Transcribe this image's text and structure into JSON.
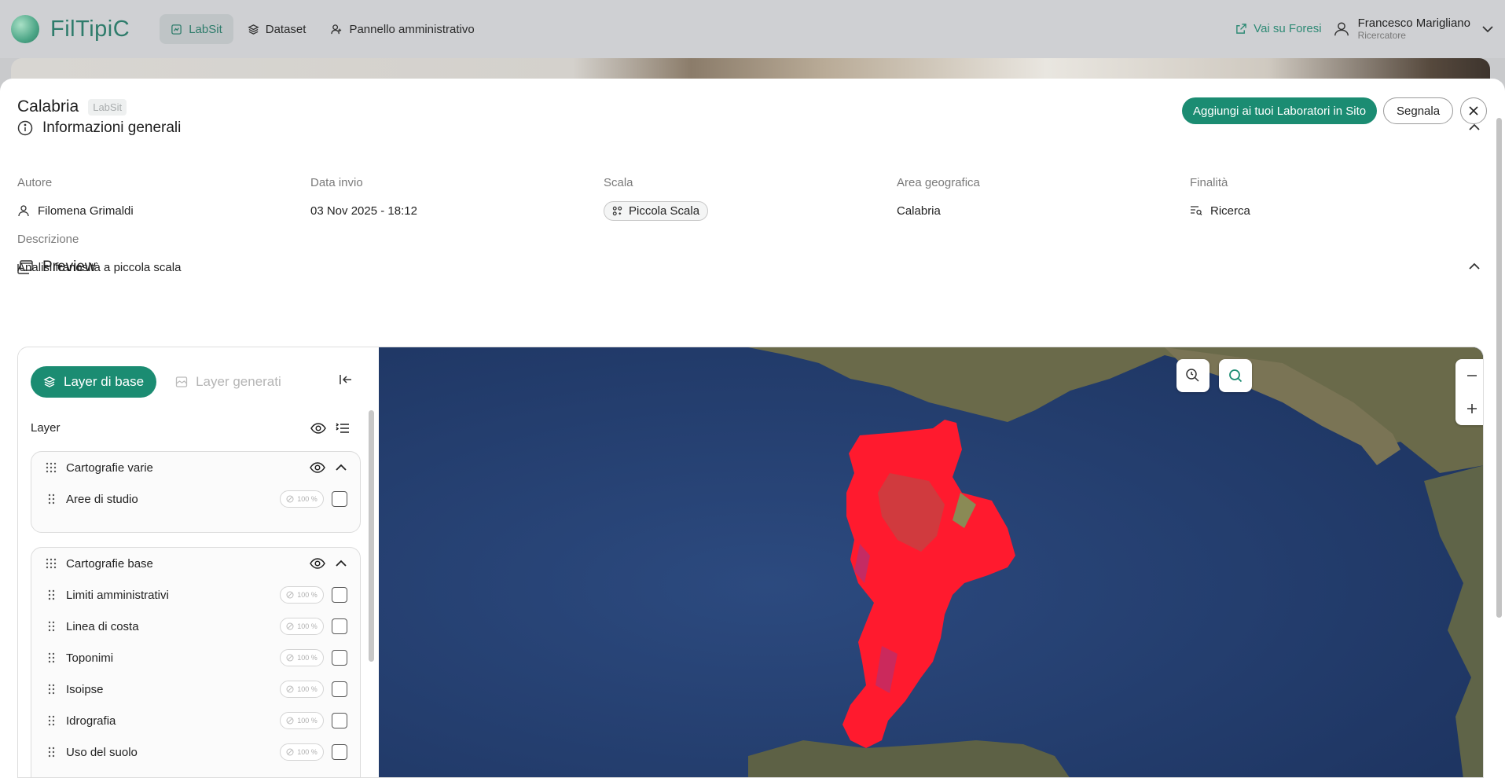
{
  "app": {
    "name": "FilTipiC"
  },
  "nav": {
    "tabs": [
      {
        "label": "LabSit",
        "icon": "lab-icon",
        "active": true
      },
      {
        "label": "Dataset",
        "icon": "layers-icon",
        "active": false
      },
      {
        "label": "Pannello amministrativo",
        "icon": "admin-users-icon",
        "active": false
      }
    ],
    "external_link": "Vai su Foresi",
    "user": {
      "name": "Francesco Marigliano",
      "role": "Ricercatore"
    }
  },
  "panel": {
    "title": "Calabria",
    "tag": "LabSit",
    "add_button": "Aggiungi ai tuoi Laboratori in Sito",
    "report_button": "Segnala"
  },
  "general_info": {
    "heading": "Informazioni generali",
    "fields": {
      "author": {
        "label": "Autore",
        "value": "Filomena Grimaldi"
      },
      "date": {
        "label": "Data invio",
        "value": "03 Nov 2025 - 18:12"
      },
      "scale": {
        "label": "Scala",
        "value": "Piccola Scala"
      },
      "area": {
        "label": "Area geografica",
        "value": "Calabria"
      },
      "purpose": {
        "label": "Finalità",
        "value": "Ricerca"
      }
    },
    "description": {
      "label": "Descrizione",
      "value": "Analisi franosità a piccola scala"
    }
  },
  "preview": {
    "heading": "Preview",
    "tabs": {
      "base": "Layer di base",
      "generated": "Layer generati"
    },
    "layer_header": "Layer",
    "groups": [
      {
        "name": "Cartografie varie",
        "layers": [
          {
            "name": "Aree di studio",
            "opacity": "100 %"
          }
        ]
      },
      {
        "name": "Cartografie base",
        "layers": [
          {
            "name": "Limiti amministrativi",
            "opacity": "100 %"
          },
          {
            "name": "Linea di costa",
            "opacity": "100 %"
          },
          {
            "name": "Toponimi",
            "opacity": "100 %"
          },
          {
            "name": "Isoipse",
            "opacity": "100 %"
          },
          {
            "name": "Idrografia",
            "opacity": "100 %"
          },
          {
            "name": "Uso del suolo",
            "opacity": "100 %"
          }
        ]
      }
    ]
  },
  "colors": {
    "accent": "#1b8c72",
    "brand": "#2e7c6b",
    "landslide": "#ff1a2e"
  }
}
